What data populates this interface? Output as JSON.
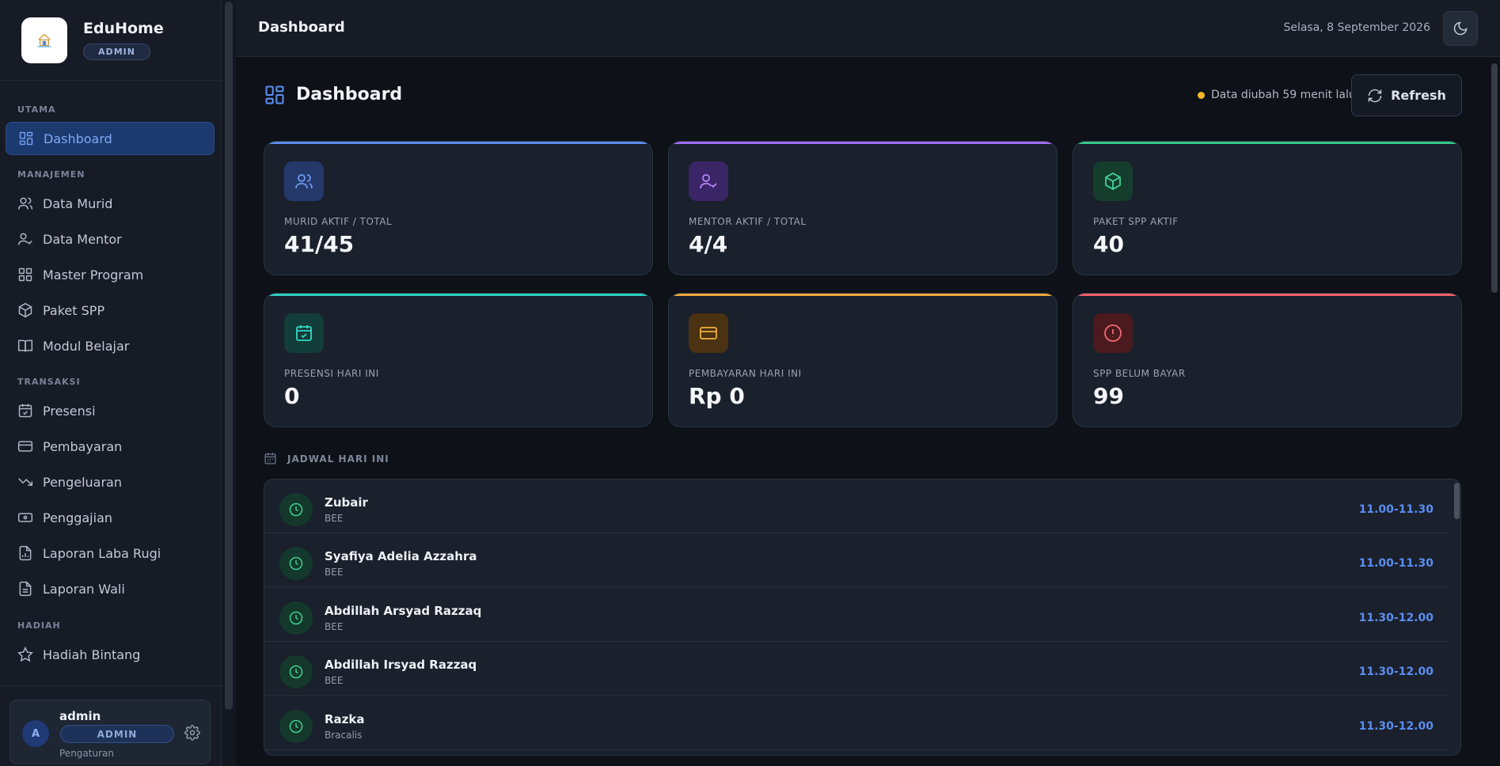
{
  "brand": {
    "name": "EduHome",
    "role": "ADMIN"
  },
  "sidebar": {
    "sections": [
      {
        "title": "UTAMA"
      },
      {
        "title": "MANAJEMEN"
      },
      {
        "title": "TRANSAKSI"
      },
      {
        "title": "HADIAH"
      }
    ],
    "items": [
      {
        "label": "Dashboard",
        "icon": "dashboard-icon",
        "active": true
      },
      {
        "label": "Data Murid",
        "icon": "users-icon"
      },
      {
        "label": "Data Mentor",
        "icon": "user-check-icon"
      },
      {
        "label": "Master Program",
        "icon": "grid-icon"
      },
      {
        "label": "Paket SPP",
        "icon": "package-icon"
      },
      {
        "label": "Modul Belajar",
        "icon": "book-icon"
      },
      {
        "label": "Presensi",
        "icon": "calendar-check-icon"
      },
      {
        "label": "Pembayaran",
        "icon": "credit-card-icon"
      },
      {
        "label": "Pengeluaran",
        "icon": "trending-down-icon"
      },
      {
        "label": "Penggajian",
        "icon": "banknote-icon"
      },
      {
        "label": "Laporan Laba Rugi",
        "icon": "file-chart-icon"
      },
      {
        "label": "Laporan Wali",
        "icon": "file-text-icon"
      },
      {
        "label": "Hadiah Bintang",
        "icon": "star-icon"
      }
    ]
  },
  "user": {
    "initial": "A",
    "name": "admin",
    "role": "ADMIN",
    "subtitle": "Pengaturan"
  },
  "topbar": {
    "title": "Dashboard",
    "date": "Selasa, 8 September 2026"
  },
  "page": {
    "title": "Dashboard",
    "status": "Data diubah 59 menit lalu",
    "refresh_label": "Refresh"
  },
  "colors": {
    "accent": "#5b8def",
    "status_dot": "#f4b728",
    "card_blue": "#5b8def",
    "card_purple": "#a06cf5",
    "card_green": "#34c98a",
    "card_teal": "#2ed0c0",
    "card_amber": "#f0a93a",
    "card_red": "#f0606a"
  },
  "stats": [
    {
      "label": "MURID AKTIF / TOTAL",
      "value": "41/45",
      "icon": "users-icon"
    },
    {
      "label": "MENTOR AKTIF / TOTAL",
      "value": "4/4",
      "icon": "user-check-icon"
    },
    {
      "label": "PAKET SPP AKTIF",
      "value": "40",
      "icon": "package-icon"
    },
    {
      "label": "PRESENSI HARI INI",
      "value": "0",
      "icon": "calendar-check-icon"
    },
    {
      "label": "PEMBAYARAN HARI INI",
      "value": "Rp 0",
      "icon": "credit-card-icon"
    },
    {
      "label": "SPP BELUM BAYAR",
      "value": "99",
      "icon": "alert-circle-icon"
    }
  ],
  "schedule": {
    "title": "JADWAL HARI INI",
    "rows": [
      {
        "name": "Zubair",
        "program": "BEE",
        "time": "11.00-11.30"
      },
      {
        "name": "Syafiya Adelia Azzahra",
        "program": "BEE",
        "time": "11.00-11.30"
      },
      {
        "name": "Abdillah Arsyad Razzaq",
        "program": "BEE",
        "time": "11.30-12.00"
      },
      {
        "name": "Abdillah Irsyad Razzaq",
        "program": "BEE",
        "time": "11.30-12.00"
      },
      {
        "name": "Razka",
        "program": "Bracalis",
        "time": "11.30-12.00"
      }
    ]
  }
}
